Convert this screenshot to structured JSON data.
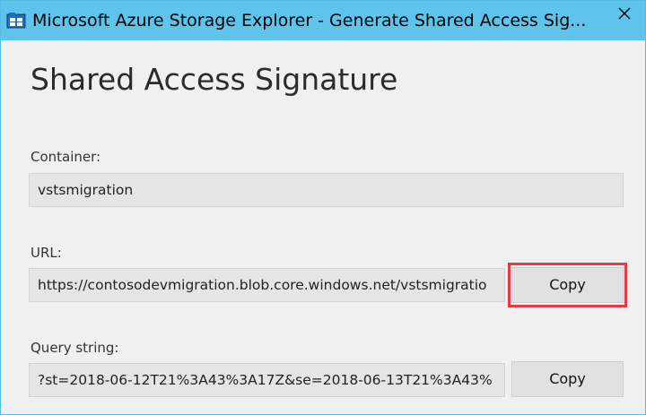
{
  "window": {
    "title": "Microsoft Azure Storage Explorer - Generate Shared Access Sig...",
    "close_glyph": "✕"
  },
  "page": {
    "title": "Shared Access Signature"
  },
  "container": {
    "label": "Container:",
    "value": "vstsmigration"
  },
  "url": {
    "label": "URL:",
    "value": "https://contosodevmigration.blob.core.windows.net/vstsmigratio",
    "copy_label": "Copy"
  },
  "query": {
    "label": "Query string:",
    "value": "?st=2018-06-12T21%3A43%3A17Z&se=2018-06-13T21%3A43%",
    "copy_label": "Copy"
  },
  "colors": {
    "titlebar": "#5fc4ec",
    "highlight": "#e03b4a",
    "background": "#f0f0f0"
  },
  "icons": {
    "app": "storage-explorer-icon",
    "close": "close-icon"
  }
}
